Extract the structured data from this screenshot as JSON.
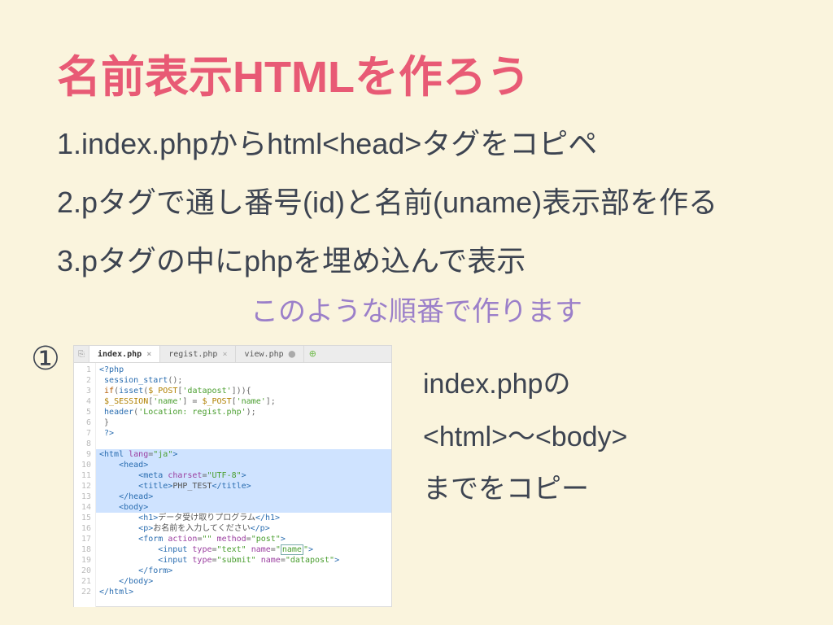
{
  "title": "名前表示HTMLを作ろう",
  "steps": {
    "s1": "1.index.phpからhtml<head>タグをコピペ",
    "s2": "2.pタグで通し番号(id)と名前(uname)表示部を作る",
    "s3": "3.pタグの中にphpを埋め込んで表示"
  },
  "subtitle": "このような順番で作ります",
  "circled": "①",
  "right": {
    "l1": "index.phpの",
    "l2": "<html>〜<body>",
    "l3": "までをコピー"
  },
  "editor": {
    "icon": "⎘",
    "tabs": [
      {
        "label": "index.php",
        "active": true,
        "closeable": true
      },
      {
        "label": "regist.php",
        "active": false,
        "closeable": true
      },
      {
        "label": "view.php",
        "active": false,
        "closeable": false
      }
    ],
    "add": "⊕",
    "lines": [
      {
        "n": 1,
        "hl": false,
        "html": "<span class='tag'>&lt;?php</span>"
      },
      {
        "n": 2,
        "hl": false,
        "html": " <span class='var'>session_start</span>();"
      },
      {
        "n": 3,
        "hl": false,
        "html": " <span class='kw'>if</span>(<span class='var'>isset</span>(<span class='lit'>$_POST</span>[<span class='str'>'datapost'</span>])){"
      },
      {
        "n": 4,
        "hl": false,
        "html": " <span class='lit'>$_SESSION</span>[<span class='str'>'name'</span>] = <span class='lit'>$_POST</span>[<span class='str'>'name'</span>];"
      },
      {
        "n": 5,
        "hl": false,
        "html": " <span class='var'>header</span>(<span class='str'>'Location: regist.php'</span>);"
      },
      {
        "n": 6,
        "hl": false,
        "html": " }"
      },
      {
        "n": 7,
        "hl": false,
        "html": " <span class='tag'>?&gt;</span>"
      },
      {
        "n": 8,
        "hl": false,
        "html": ""
      },
      {
        "n": 9,
        "hl": true,
        "html": "<span class='tag'>&lt;html</span> <span class='attr'>lang</span>=<span class='str'>\"ja\"</span><span class='tag'>&gt;</span>"
      },
      {
        "n": 10,
        "hl": true,
        "html": "    <span class='tag'>&lt;head&gt;</span>"
      },
      {
        "n": 11,
        "hl": true,
        "html": "        <span class='tag'>&lt;meta</span> <span class='attr'>charset</span>=<span class='str'>\"UTF-8\"</span><span class='tag'>&gt;</span>"
      },
      {
        "n": 12,
        "hl": true,
        "html": "        <span class='tag'>&lt;title&gt;</span><span class='txt'>PHP_TEST</span><span class='tag'>&lt;/title&gt;</span>"
      },
      {
        "n": 13,
        "hl": true,
        "html": "    <span class='tag'>&lt;/head&gt;</span>"
      },
      {
        "n": 14,
        "hl": true,
        "html": "    <span class='tag'>&lt;body&gt;</span>"
      },
      {
        "n": 15,
        "hl": false,
        "html": "        <span class='tag'>&lt;h1&gt;</span><span class='txt'>データ受け取りプログラム</span><span class='tag'>&lt;/h1&gt;</span>"
      },
      {
        "n": 16,
        "hl": false,
        "html": "        <span class='tag'>&lt;p&gt;</span><span class='txt'>お名前を入力してください</span><span class='tag'>&lt;/p&gt;</span>"
      },
      {
        "n": 17,
        "hl": false,
        "html": "        <span class='tag'>&lt;form</span> <span class='attr'>action</span>=<span class='str'>\"\"</span> <span class='attr'>method</span>=<span class='str'>\"post\"</span><span class='tag'>&gt;</span>"
      },
      {
        "n": 18,
        "hl": false,
        "html": "            <span class='tag'>&lt;input</span> <span class='attr'>type</span>=<span class='str'>\"text\"</span> <span class='attr'>name</span>=<span class='str'>\"<span class='boxsel'>name</span>\"</span><span class='tag'>&gt;</span>"
      },
      {
        "n": 19,
        "hl": false,
        "html": "            <span class='tag'>&lt;input</span> <span class='attr'>type</span>=<span class='str'>\"submit\"</span> <span class='attr'>name</span>=<span class='str'>\"datapost\"</span><span class='tag'>&gt;</span>"
      },
      {
        "n": 20,
        "hl": false,
        "html": "        <span class='tag'>&lt;/form&gt;</span>"
      },
      {
        "n": 21,
        "hl": false,
        "html": "    <span class='tag'>&lt;/body&gt;</span>"
      },
      {
        "n": 22,
        "hl": false,
        "html": "<span class='tag'>&lt;/html&gt;</span>"
      }
    ]
  }
}
